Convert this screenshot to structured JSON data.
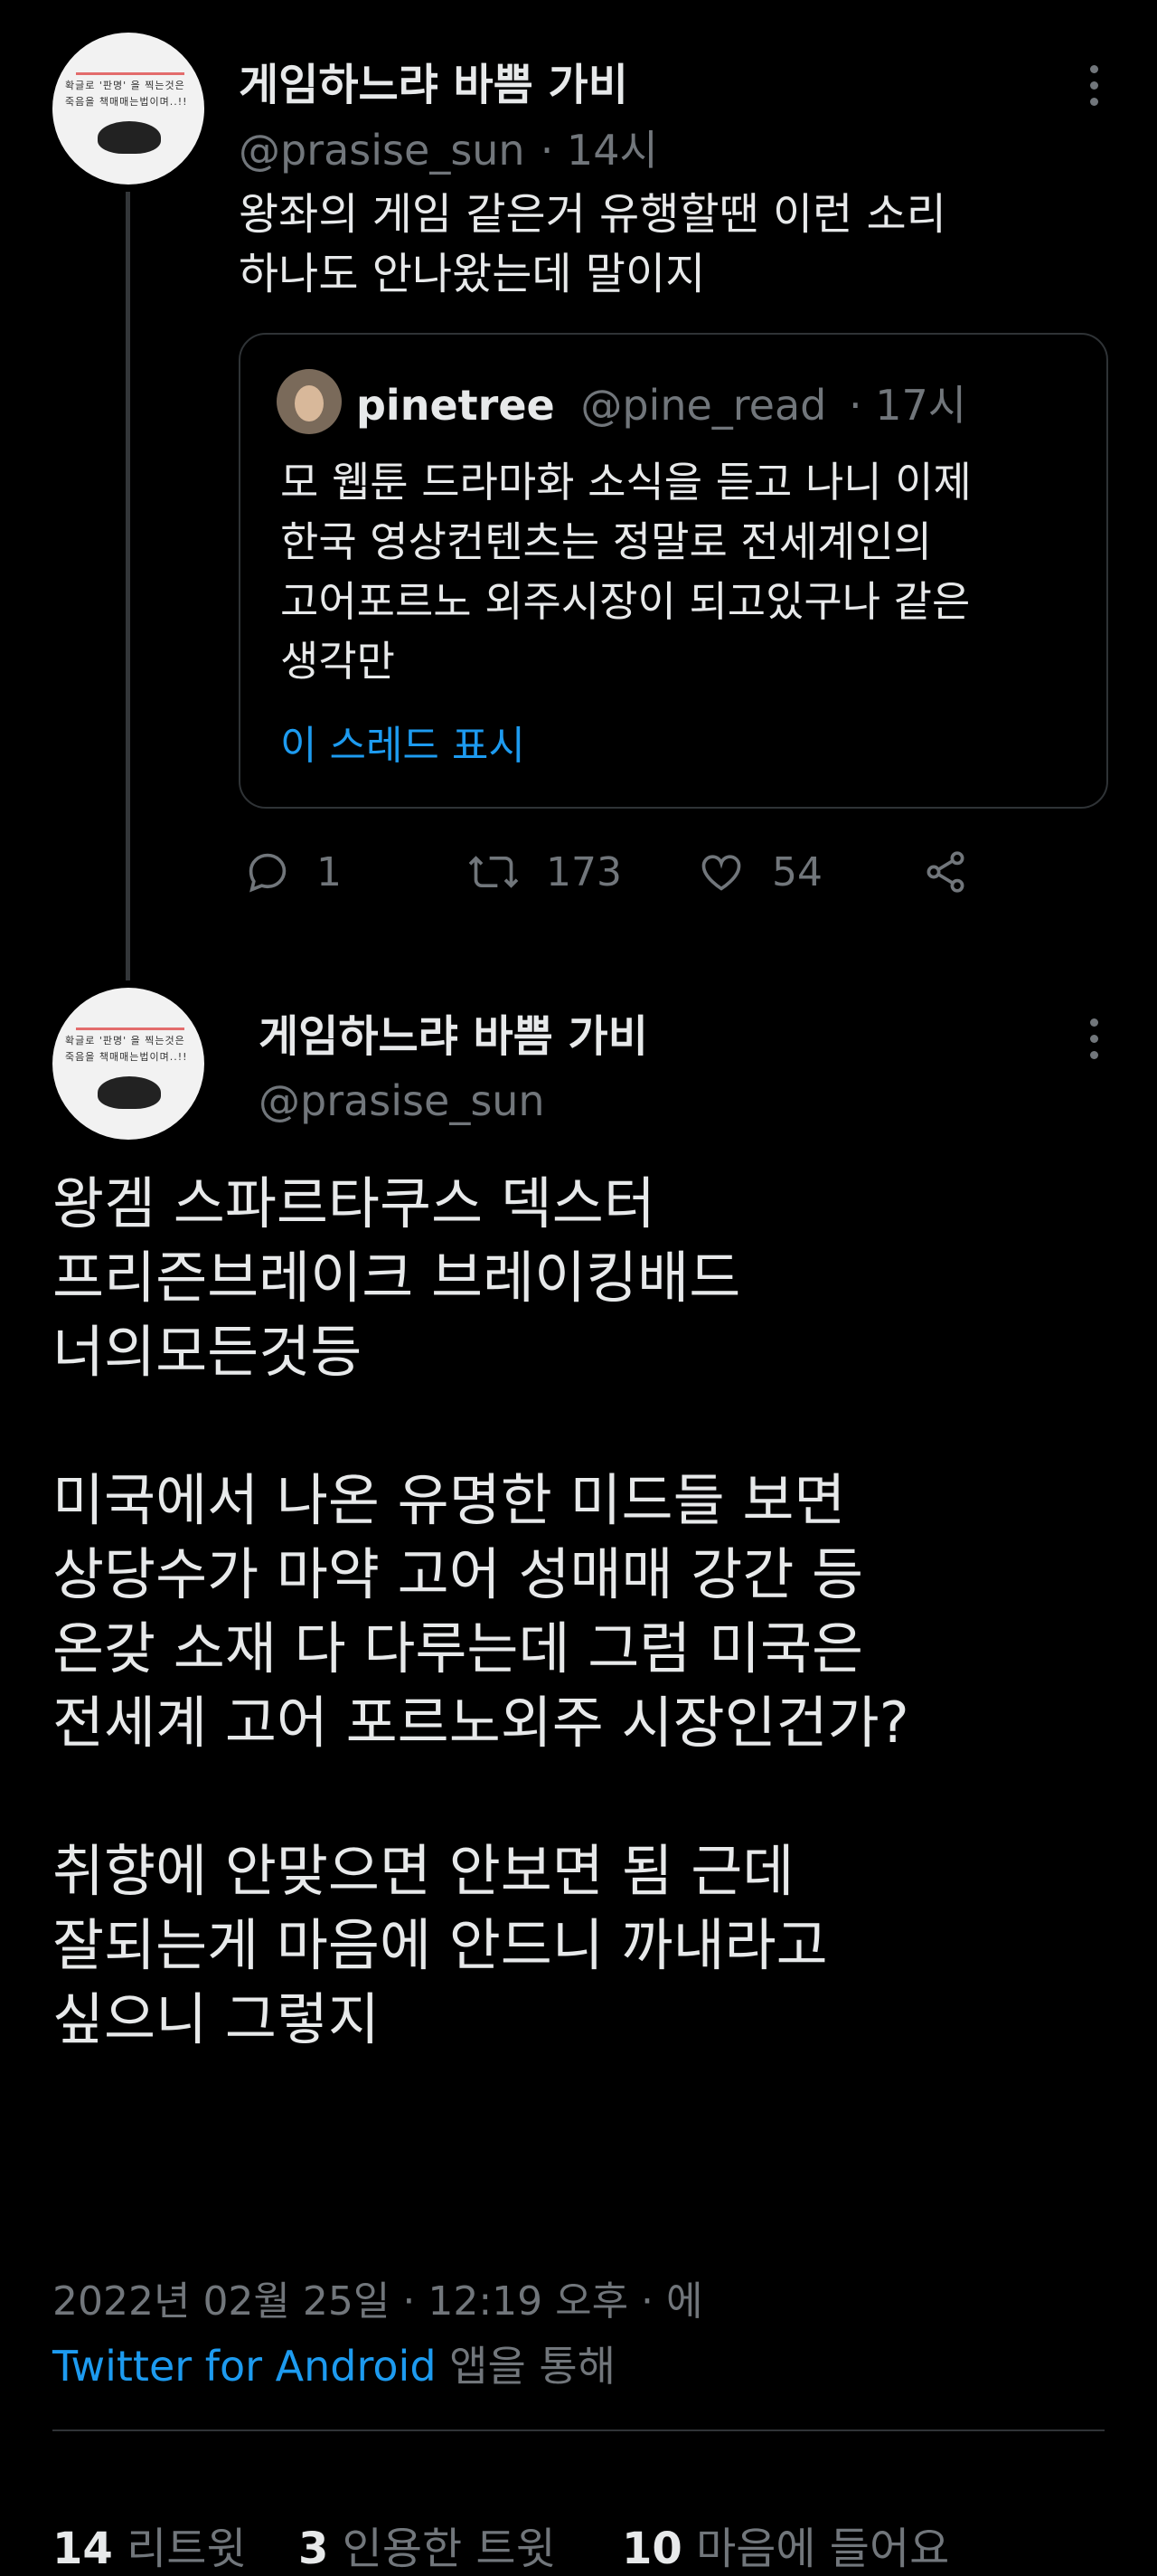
{
  "colors": {
    "background": "#000000",
    "text": "#e7e9ea",
    "muted": "#71767b",
    "link": "#1d9bf0",
    "border": "#2f3336"
  },
  "tweet1": {
    "avatar_text": "확글로 '판명' 을 찍는것은\n죽음을 책매매는법이며..!!",
    "name": "게임하느랴 바쁨 가비",
    "handle": "@prasise_sun",
    "time": "· 14시",
    "text": "왕좌의 게임 같은거 유행할땐 이런 소리\n하나도 안나왔는데 말이지",
    "quote": {
      "name": "pinetree",
      "handle": "@pine_read",
      "time": "· 17시",
      "text": "모 웹툰 드라마화 소식을 듣고 나니 이제\n한국 영상컨텐츠는 정말로 전세계인의\n고어포르노 외주시장이 되고있구나 같은\n생각만",
      "show_thread": "이 스레드 표시"
    },
    "actions": {
      "reply_icon": "reply-icon",
      "replies": "1",
      "retweet_icon": "retweet-icon",
      "retweets": "173",
      "like_icon": "heart-icon",
      "likes": "54",
      "share_icon": "share-icon"
    }
  },
  "tweet2": {
    "avatar_text": "확글로 '판명' 을 찍는것은\n죽음을 책매매는법이며..!!",
    "name": "게임하느랴 바쁨 가비",
    "handle": "@prasise_sun",
    "text": "왕겜 스파르타쿠스 덱스터\n프리즌브레이크 브레이킹배드\n너의모든것등\n\n미국에서 나온 유명한 미드들 보면\n상당수가 마약 고어 성매매 강간 등\n온갖 소재 다 다루는데 그럼 미국은\n전세계 고어 포르노외주 시장인건가?\n\n취향에 안맞으면 안보면 됨 근데\n잘되는게 마음에 안드니 까내라고\n싶으니 그렇지",
    "timestamp": "2022년 02월 25일 · 12:19 오후 · 에",
    "source_app": "Twitter for Android",
    "source_suffix": " 앱을 통해",
    "stats": {
      "retweets": "14",
      "retweets_label": "리트윗",
      "quotes": "3",
      "quotes_label": "인용한 트윗",
      "likes": "10",
      "likes_label": "마음에 들어요"
    }
  }
}
